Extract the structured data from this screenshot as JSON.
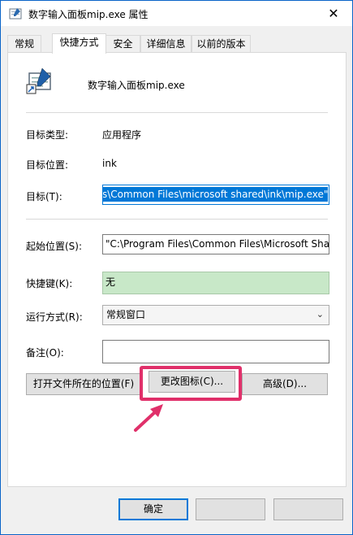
{
  "window": {
    "title": "数字输入面板mip.exe  属性",
    "close_glyph": "✕"
  },
  "tabs": [
    {
      "label": "常规"
    },
    {
      "label": "快捷方式",
      "active": true
    },
    {
      "label": "安全"
    },
    {
      "label": "详细信息"
    },
    {
      "label": "以前的版本"
    }
  ],
  "shortcut": {
    "app_name": "数字输入面板mip.exe",
    "target_type_label": "目标类型:",
    "target_type_value": "应用程序",
    "target_location_label": "目标位置:",
    "target_location_value": "ink",
    "target_label": "目标(T):",
    "target_value": "s\\Common Files\\microsoft shared\\ink\\mip.exe\"",
    "start_in_label": "起始位置(S):",
    "start_in_value": "\"C:\\Program Files\\Common Files\\Microsoft Sha",
    "hotkey_label": "快捷键(K):",
    "hotkey_value": "无",
    "run_label": "运行方式(R):",
    "run_value": "常规窗口",
    "comment_label": "备注(O):",
    "comment_value": ""
  },
  "buttons": {
    "open_location": "打开文件所在的位置(F)",
    "change_icon": "更改图标(C)...",
    "advanced": "高级(D)...",
    "ok": "确定"
  },
  "colors": {
    "highlight": "#e0306a",
    "selection": "#0078d7",
    "hotkey_bg": "#c8e8c8"
  }
}
